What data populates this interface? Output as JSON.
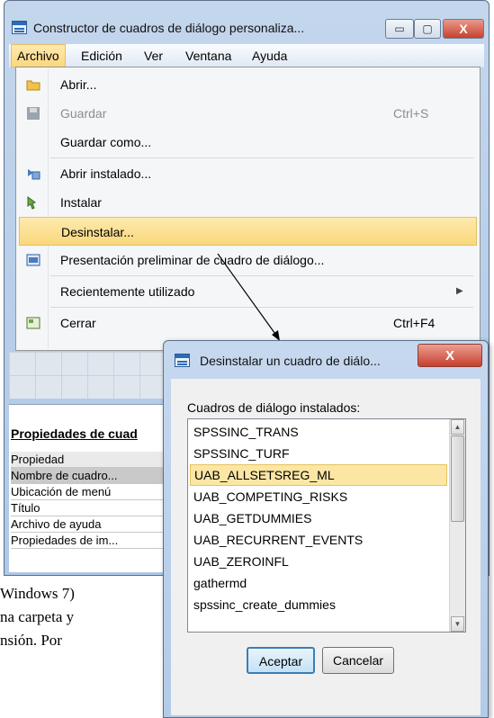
{
  "background_text": {
    "line1": "Windows 7)",
    "line2": "na carpeta y",
    "line3": "nsión. Por"
  },
  "main_window": {
    "title": "Constructor de cuadros de diálogo personaliza...",
    "controls": {
      "minimize": "▭",
      "maximize": "▢",
      "close": "X"
    },
    "menubar": [
      "Archivo",
      "Edición",
      "Ver",
      "Ventana",
      "Ayuda"
    ],
    "file_menu": {
      "open": "Abrir...",
      "save": "Guardar",
      "save_shortcut": "Ctrl+S",
      "save_as": "Guardar como...",
      "open_installed": "Abrir instalado...",
      "install": "Instalar",
      "uninstall": "Desinstalar...",
      "preview": "Presentación preliminar de cuadro de diálogo...",
      "recent": "Recientemente utilizado",
      "close": "Cerrar",
      "close_shortcut": "Ctrl+F4"
    },
    "properties": {
      "title": "Propiedades de cuad",
      "header": "Propiedad",
      "rows": [
        "Nombre de cuadro...",
        "Ubicación de menú",
        "Título",
        "Archivo de ayuda",
        "Propiedades de im..."
      ]
    }
  },
  "dialog": {
    "title": "Desinstalar un cuadro de diálo...",
    "close": "X",
    "label": "Cuadros de diálogo instalados:",
    "items": [
      "SPSSINC_TRANS",
      "SPSSINC_TURF",
      "UAB_ALLSETSREG_ML",
      "UAB_COMPETING_RISKS",
      "UAB_GETDUMMIES",
      "UAB_RECURRENT_EVENTS",
      "UAB_ZEROINFL",
      "gathermd",
      "spssinc_create_dummies"
    ],
    "selected_index": 2,
    "ok": "Aceptar",
    "cancel": "Cancelar"
  },
  "colors": {
    "highlight": "#fad77b",
    "selection": "#fce6a4",
    "title_bar": "#c3d6ec"
  },
  "icons": [
    "folder-icon",
    "save-icon",
    "open-installed-icon",
    "install-icon",
    "preview-icon",
    "close-dialog-icon"
  ]
}
